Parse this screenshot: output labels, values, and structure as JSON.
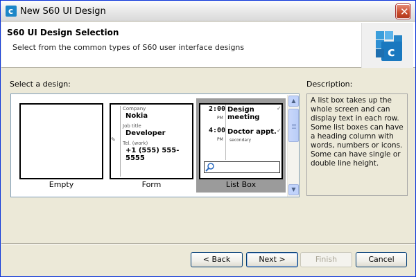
{
  "window": {
    "title": "New S60 UI Design",
    "close_label": "✕"
  },
  "banner": {
    "title": "S60 UI Design Selection",
    "description": "Select from the common types of S60 user interface designs"
  },
  "gallery": {
    "label": "Select a design:",
    "designs": [
      {
        "name": "Empty"
      },
      {
        "name": "Form",
        "fields": [
          {
            "label": "Company",
            "value": "Nokia"
          },
          {
            "label": "Job title",
            "value": "Developer"
          },
          {
            "label": "Tel. (work)",
            "value": "+1 (555) 555-5555"
          }
        ]
      },
      {
        "name": "List Box",
        "items": [
          {
            "time": "2:00",
            "ampm": "PM",
            "title": "Design meeting",
            "subtitle": ""
          },
          {
            "time": "4:00",
            "ampm": "PM",
            "title": "Doctor appt.",
            "subtitle": "secondary"
          }
        ]
      }
    ],
    "selected": "List Box"
  },
  "description": {
    "label": "Description:",
    "text": "A list box takes up the whole screen and can display text in each row. Some list boxes can have a heading column with words, numbers or icons. Some can have single or double line height."
  },
  "buttons": {
    "back": "< Back",
    "next": "Next >",
    "finish": "Finish",
    "cancel": "Cancel"
  }
}
